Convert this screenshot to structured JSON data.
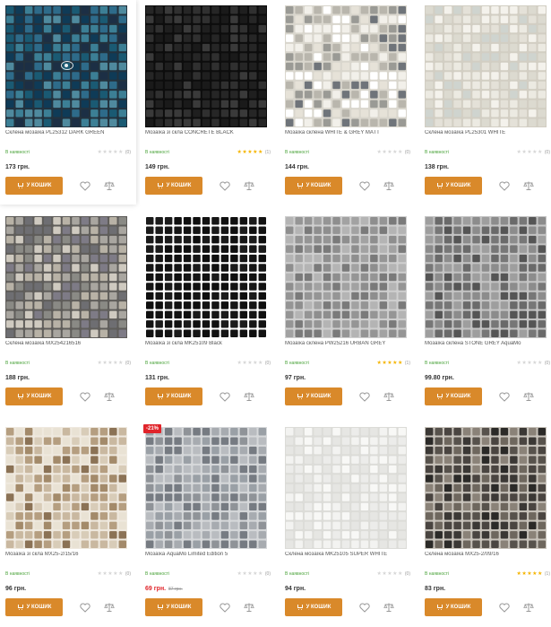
{
  "currency": "грн.",
  "buy_label": "У КОШИК",
  "products": [
    {
      "name": "Склена мозаїка PL25312 DARK GREEN",
      "stock": "В наявності",
      "rating": 0,
      "reviews": "(0)",
      "price": "173",
      "palette": [
        "#0f3b57",
        "#1a5a73",
        "#2e6b8a",
        "#3c7f95",
        "#1c2f45",
        "#4f8a9e"
      ],
      "grout": "#23323e"
    },
    {
      "name": "Мозаїка зі скла CONCRETE BLACK",
      "stock": "В наявності",
      "rating": 5,
      "reviews": "(1)",
      "price": "149",
      "palette": [
        "#1a1a1a",
        "#262626",
        "#303030",
        "#1f1f1f",
        "#3a3a3a"
      ],
      "grout": "#0d0d0d"
    },
    {
      "name": "Мозаїка склена WHITE & GREY MATT",
      "stock": "В наявності",
      "rating": 0,
      "reviews": "(0)",
      "price": "144",
      "palette": [
        "#f2f0ea",
        "#e6e2d8",
        "#9a9a95",
        "#6f747a",
        "#b9b6ad",
        "#ffffff"
      ],
      "grout": "#d9d6cd"
    },
    {
      "name": "Склена мозаїка PL25301 WHITE",
      "stock": "В наявності",
      "rating": 0,
      "reviews": "(0)",
      "price": "138",
      "palette": [
        "#eceae2",
        "#f4f2ec",
        "#dcdad0",
        "#e4e1d8",
        "#cfd4cf"
      ],
      "grout": "#d2cec3"
    },
    {
      "name": "Склена мозаїка MX254216516",
      "stock": "В наявності",
      "rating": 0,
      "reviews": "(0)",
      "price": "188",
      "palette": [
        "#8a8a85",
        "#a9a6a0",
        "#6e6e72",
        "#b8b2a6",
        "#7e7b86",
        "#cfcac0"
      ],
      "grout": "#5f5d5a"
    },
    {
      "name": "Мозаїка зі скла MK25109 Black",
      "stock": "В наявності",
      "rating": 0,
      "reviews": "(0)",
      "price": "131",
      "palette": [
        "#0f0f0f",
        "#161616",
        "#1b1b1b",
        "#121212"
      ],
      "grout": "#ffffff"
    },
    {
      "name": "Мозаїка склена PW25216 URBAN GREY",
      "stock": "В наявності",
      "rating": 5,
      "reviews": "(1)",
      "price": "97",
      "palette": [
        "#8e8e8e",
        "#a2a2a2",
        "#7a7a7a",
        "#b4b4b4",
        "#959595"
      ],
      "grout": "#cfcfcf"
    },
    {
      "name": "Мозаїка склена STONE GREY AquaMo",
      "stock": "В наявності",
      "rating": 0,
      "reviews": "(0)",
      "price": "99.80",
      "palette": [
        "#6a6a6a",
        "#8c8c8c",
        "#555555",
        "#9e9e9e",
        "#777777"
      ],
      "grout": "#c4c4c4"
    },
    {
      "name": "Мозаїка зі скла MX25-2/15/16",
      "stock": "В наявності",
      "rating": 0,
      "reviews": "(0)",
      "price": "96",
      "palette": [
        "#c9b8a0",
        "#a38a6a",
        "#e9e2d4",
        "#8b7255",
        "#d8ccb8",
        "#b59e80"
      ],
      "grout": "#efe9df"
    },
    {
      "name": "Мозаїка AquaMo Limited Edition 5",
      "stock": "В наявності",
      "rating": 0,
      "reviews": "(0)",
      "price": "69",
      "old_price": "87 грн.",
      "badge": "-21%",
      "palette": [
        "#8f9398",
        "#a7abb0",
        "#767b82",
        "#b9bcc0",
        "#9aa0a6"
      ],
      "grout": "#d6d8da"
    },
    {
      "name": "Склена мозаїка MK25105 SUPER WHITE",
      "stock": "В наявності",
      "rating": 0,
      "reviews": "(0)",
      "price": "94",
      "palette": [
        "#f3f3f1",
        "#ececea",
        "#f8f8f6",
        "#e6e6e3"
      ],
      "grout": "#dcdcd8"
    },
    {
      "name": "Склена мозаїка MX25-2/09/16",
      "stock": "В наявності",
      "rating": 5,
      "reviews": "(1)",
      "price": "83",
      "palette": [
        "#3b3835",
        "#57524c",
        "#2b2a28",
        "#6e675e",
        "#8a8278",
        "#4a4541"
      ],
      "grout": "#c8c3bb"
    }
  ]
}
